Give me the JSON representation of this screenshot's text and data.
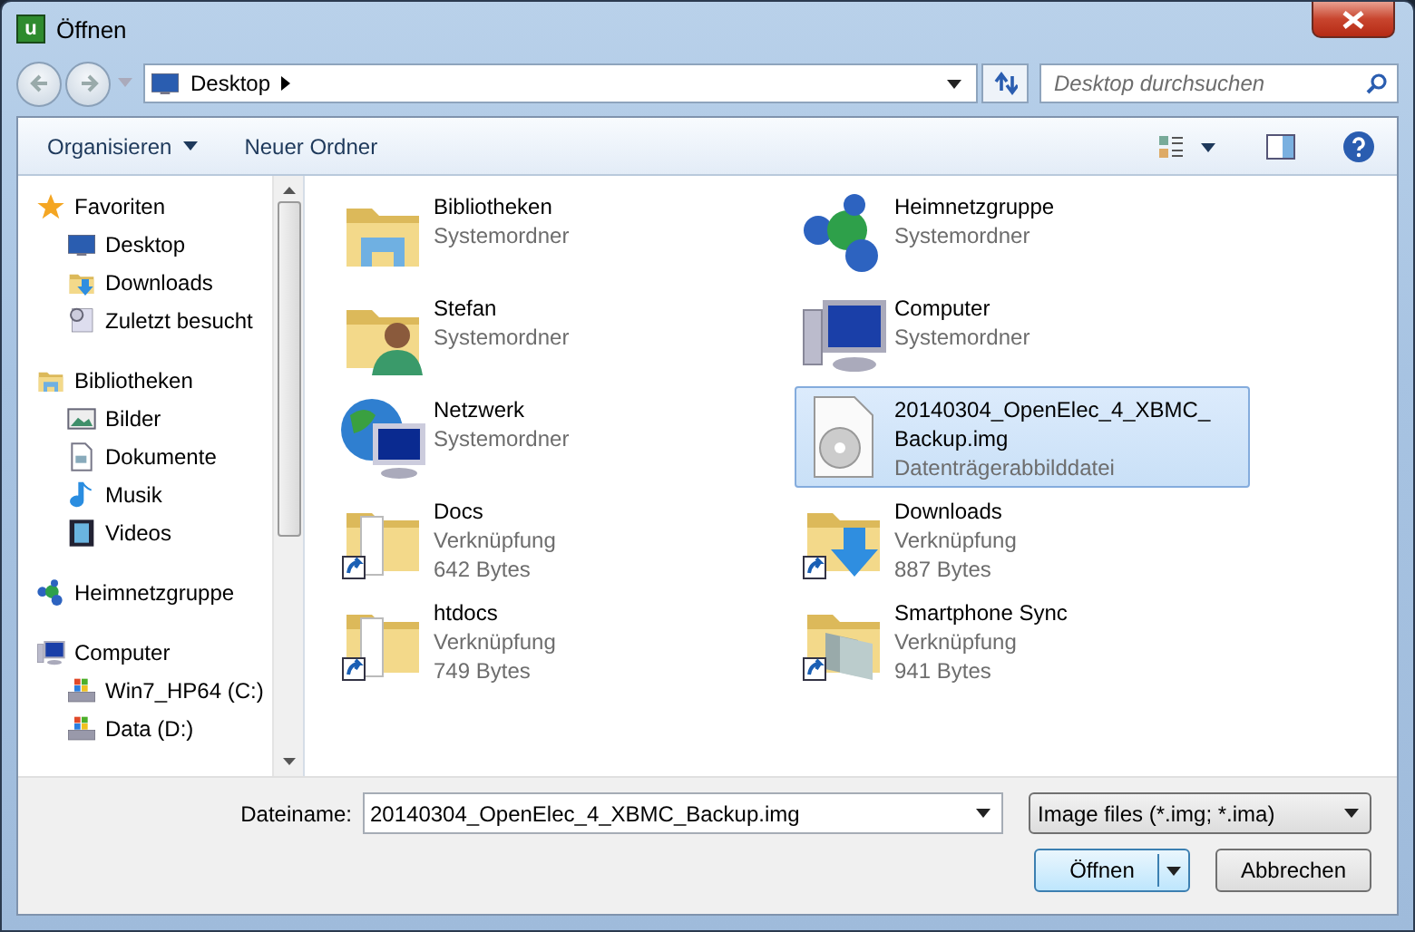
{
  "window": {
    "title": "Öffnen",
    "icon_text": "u"
  },
  "address": {
    "location": "Desktop"
  },
  "search": {
    "placeholder": "Desktop durchsuchen"
  },
  "toolbar": {
    "organize": "Organisieren",
    "new_folder": "Neuer Ordner"
  },
  "nav": [
    {
      "label": "Favoriten",
      "children": [
        {
          "label": "Desktop"
        },
        {
          "label": "Downloads"
        },
        {
          "label": "Zuletzt besucht"
        }
      ]
    },
    {
      "label": "Bibliotheken",
      "children": [
        {
          "label": "Bilder"
        },
        {
          "label": "Dokumente"
        },
        {
          "label": "Musik"
        },
        {
          "label": "Videos"
        }
      ]
    },
    {
      "label": "Heimnetzgruppe"
    },
    {
      "label": "Computer",
      "children": [
        {
          "label": "Win7_HP64 (C:)"
        },
        {
          "label": "Data (D:)"
        }
      ]
    }
  ],
  "items": [
    {
      "name": "Bibliotheken",
      "lines": [
        "Systemordner"
      ],
      "selected": false
    },
    {
      "name": "Heimnetzgruppe",
      "lines": [
        "Systemordner"
      ],
      "selected": false
    },
    {
      "name": "Stefan",
      "lines": [
        "Systemordner"
      ],
      "selected": false
    },
    {
      "name": "Computer",
      "lines": [
        "Systemordner"
      ],
      "selected": false
    },
    {
      "name": "Netzwerk",
      "lines": [
        "Systemordner"
      ],
      "selected": false
    },
    {
      "name": "20140304_OpenElec_4_XBMC_Backup.img",
      "lines": [
        "Datenträgerabbilddatei"
      ],
      "selected": true
    },
    {
      "name": "Docs",
      "lines": [
        "Verknüpfung",
        "642 Bytes"
      ],
      "selected": false
    },
    {
      "name": "Downloads",
      "lines": [
        "Verknüpfung",
        "887 Bytes"
      ],
      "selected": false
    },
    {
      "name": "htdocs",
      "lines": [
        "Verknüpfung",
        "749 Bytes"
      ],
      "selected": false
    },
    {
      "name": "Smartphone Sync",
      "lines": [
        "Verknüpfung",
        "941 Bytes"
      ],
      "selected": false
    }
  ],
  "file_name": {
    "label": "Dateiname:",
    "value": "20140304_OpenElec_4_XBMC_Backup.img"
  },
  "file_type": {
    "value": "Image files (*.img; *.ima)"
  },
  "buttons": {
    "open": "Öffnen",
    "cancel": "Abbrechen"
  }
}
